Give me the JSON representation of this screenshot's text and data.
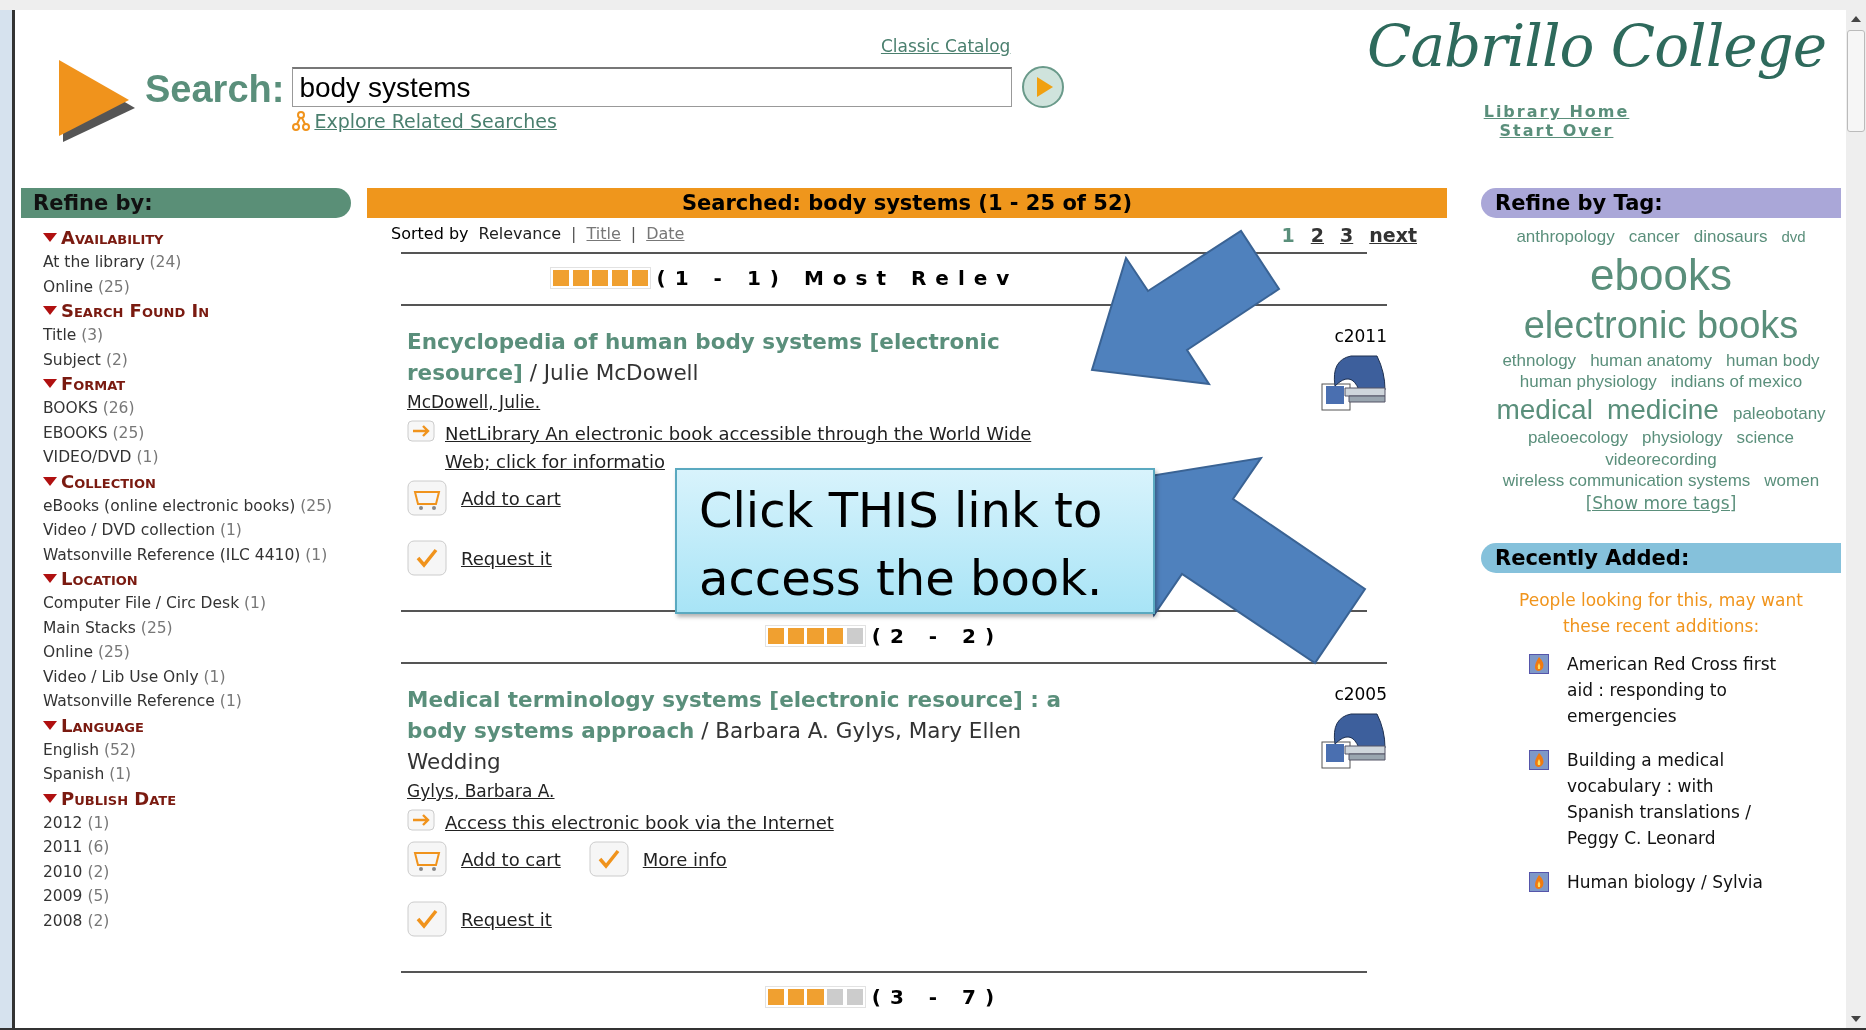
{
  "header": {
    "search_label": "Search:",
    "search_value": "body systems",
    "classic_catalog": "Classic Catalog",
    "explore_related": "Explore Related Searches",
    "logo": "Cabrillo College",
    "library_home": "Library Home",
    "start_over": "Start Over"
  },
  "refine": {
    "title": "Refine by:",
    "facets": [
      {
        "name": "Availability",
        "items": [
          {
            "label": "At the library",
            "count": "(24)"
          },
          {
            "label": "Online",
            "count": "(25)"
          }
        ]
      },
      {
        "name": "Search Found In",
        "items": [
          {
            "label": "Title",
            "count": "(3)"
          },
          {
            "label": "Subject",
            "count": "(2)"
          }
        ]
      },
      {
        "name": "Format",
        "items": [
          {
            "label": "BOOKS",
            "count": "(26)"
          },
          {
            "label": "EBOOKS",
            "count": "(25)"
          },
          {
            "label": "VIDEO/DVD",
            "count": "(1)"
          }
        ]
      },
      {
        "name": "Collection",
        "items": [
          {
            "label": "eBooks (online electronic books)",
            "count": "(25)"
          },
          {
            "label": "Video / DVD collection",
            "count": "(1)"
          },
          {
            "label": "Watsonville Reference (ILC 4410)",
            "count": "(1)"
          }
        ]
      },
      {
        "name": "Location",
        "items": [
          {
            "label": "Computer File / Circ Desk",
            "count": "(1)"
          },
          {
            "label": "Main Stacks",
            "count": "(25)"
          },
          {
            "label": "Online",
            "count": "(25)"
          },
          {
            "label": "Video / Lib Use Only",
            "count": "(1)"
          },
          {
            "label": "Watsonville Reference",
            "count": "(1)"
          }
        ]
      },
      {
        "name": "Language",
        "items": [
          {
            "label": "English",
            "count": "(52)"
          },
          {
            "label": "Spanish",
            "count": "(1)"
          }
        ]
      },
      {
        "name": "Publish Date",
        "items": [
          {
            "label": "2012",
            "count": "(1)"
          },
          {
            "label": "2011",
            "count": "(6)"
          },
          {
            "label": "2010",
            "count": "(2)"
          },
          {
            "label": "2009",
            "count": "(5)"
          },
          {
            "label": "2008",
            "count": "(2)"
          }
        ]
      }
    ]
  },
  "results": {
    "banner": "Searched: body systems (1 - 25 of 52)",
    "sorted_by": "Sorted by",
    "separator": "|",
    "sort_options": [
      {
        "label": "Relevance",
        "selected": true
      },
      {
        "label": "Title",
        "selected": false
      },
      {
        "label": "Date",
        "selected": false
      }
    ],
    "pages": [
      {
        "label": "1",
        "selected": true
      },
      {
        "label": "2",
        "selected": false
      },
      {
        "label": "3",
        "selected": false
      }
    ],
    "next": "next",
    "groups": [
      {
        "heading": "(1 - 1) Most Relev",
        "level": 1,
        "records": [
          {
            "title": "Encyclopedia of human body systems [electronic resource]",
            "responsibility": "/ Julie McDowell",
            "author": "McDowell, Julie.",
            "date": "c2011",
            "access_link": "NetLibrary An electronic book accessible through the World Wide Web; click for informatio",
            "actions": [
              {
                "kind": "cart",
                "label": "Add to cart"
              },
              {
                "kind": "break"
              },
              {
                "kind": "check",
                "label": "Request it"
              }
            ]
          }
        ]
      },
      {
        "heading": "(2 - 2)",
        "level": 0.8,
        "records": [
          {
            "title": "Medical terminology systems [electronic resource] : a body systems approach",
            "responsibility": "/ Barbara A. Gylys, Mary Ellen Wedding",
            "author": "Gylys, Barbara A.",
            "date": "c2005",
            "access_link": "Access this electronic book via the Internet",
            "actions": [
              {
                "kind": "cart",
                "label": "Add to cart"
              },
              {
                "kind": "check",
                "label": "More info"
              },
              {
                "kind": "break"
              },
              {
                "kind": "check",
                "label": "Request it"
              }
            ]
          }
        ]
      },
      {
        "heading": "(3 - 7)",
        "level": 0.6
      }
    ]
  },
  "tags": {
    "title": "Refine by Tag:",
    "items": [
      {
        "label": "anthropology",
        "kind": "s"
      },
      {
        "label": "cancer",
        "kind": "s"
      },
      {
        "label": "dinosaurs",
        "kind": "s"
      },
      {
        "label": "dvd",
        "kind": "xs"
      },
      {
        "label": "ebooks",
        "kind": "xl"
      },
      {
        "label": "electronic books",
        "kind": "l"
      },
      {
        "label": "ethnology",
        "kind": "s"
      },
      {
        "label": "human anatomy",
        "kind": "s"
      },
      {
        "label": "human body",
        "kind": "s"
      },
      {
        "label": "human physiology",
        "kind": "s"
      },
      {
        "label": "indians of mexico",
        "kind": "s"
      },
      {
        "label": "medical",
        "kind": "m"
      },
      {
        "label": "medicine",
        "kind": "m"
      },
      {
        "label": "paleobotany",
        "kind": "s"
      },
      {
        "label": "paleoecology",
        "kind": "s"
      },
      {
        "label": "physiology",
        "kind": "s"
      },
      {
        "label": "science",
        "kind": "s"
      },
      {
        "label": "videorecording",
        "kind": "s"
      },
      {
        "label": "wireless communication systems",
        "kind": "s"
      },
      {
        "label": "women",
        "kind": "s"
      }
    ],
    "show_more": "[Show more tags]"
  },
  "recent": {
    "title": "Recently Added:",
    "intro": "People looking for this, may want these recent additions:",
    "items": [
      "American Red Cross first aid : responding to emergencies",
      "Building a medical vocabulary : with Spanish translations / Peggy C. Leonard",
      "Human biology / Sylvia"
    ]
  },
  "callout": {
    "text": "Click THIS link to access the book."
  }
}
